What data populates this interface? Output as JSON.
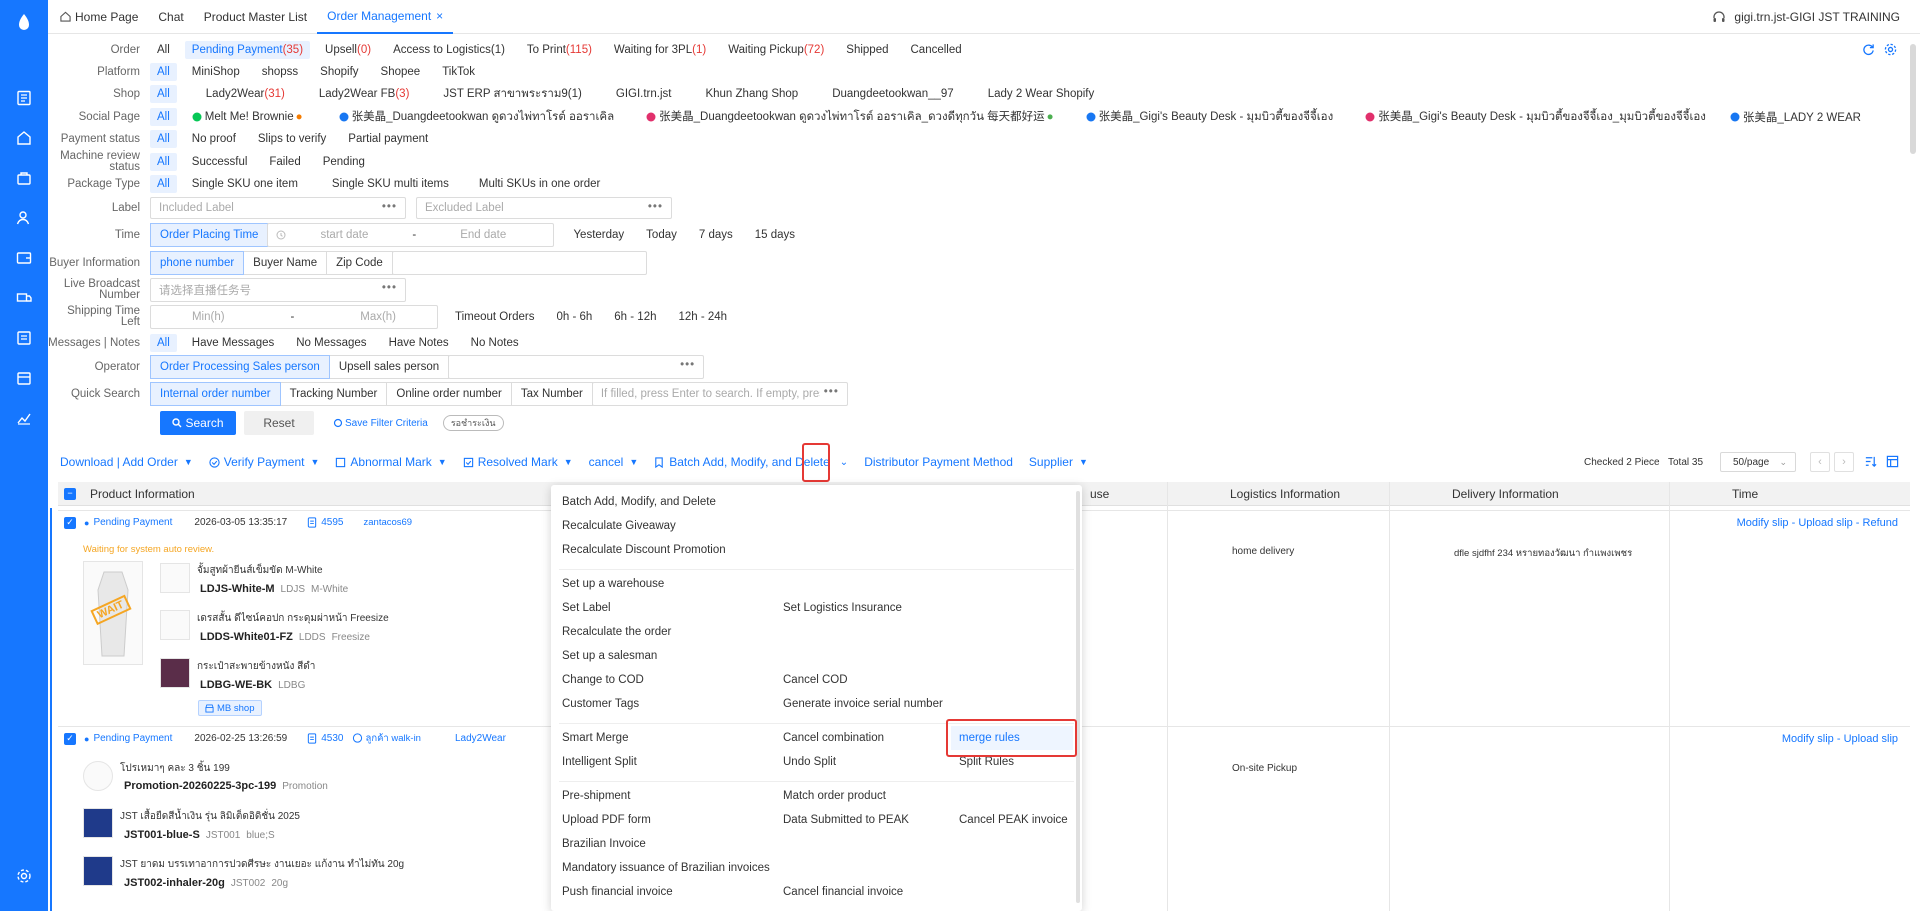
{
  "topbar": {
    "tabs": [
      "Home Page",
      "Chat",
      "Product Master List",
      "Order Management"
    ],
    "close": "×",
    "user": "gigi.trn.jst-GIGI JST TRAINING"
  },
  "filters": {
    "order": {
      "label": "Order",
      "options": [
        "All",
        "Pending Payment",
        "Upsell",
        "Access to Logistics",
        "To Print",
        "Waiting for 3PL",
        "Waiting Pickup",
        "Shipped",
        "Cancelled"
      ],
      "counts": [
        "",
        "(35)",
        "(0)",
        "(1)",
        "(115)",
        "(1)",
        "(72)",
        "",
        ""
      ]
    },
    "platform": {
      "label": "Platform",
      "options": [
        "All",
        "MiniShop",
        "shopss",
        "Shopify",
        "Shopee",
        "TikTok"
      ]
    },
    "shop": {
      "label": "Shop",
      "options": [
        "All",
        "Lady2Wear",
        "Lady2Wear FB",
        "JST ERP สาขาพระราม9(1)",
        "GIGI.trn.jst",
        "Khun Zhang Shop",
        "Duangdeetookwan__97",
        "Lady 2 Wear Shopify"
      ],
      "counts": [
        "",
        "(31)",
        "(3)",
        "",
        "",
        "",
        "",
        ""
      ]
    },
    "social": {
      "label": "Social Page",
      "options": [
        "All",
        "Melt Me! Brownie",
        "张美晶_Duangdeetookwan ดูดวงไพ่ทาโรต์ ออราเคิล",
        "张美晶_Duangdeetookwan ดูดวงไพ่ทาโรต์ ออราเคิล_ดวงดีทุกวัน 每天都好运",
        "张美晶_Gigi's Beauty Desk - มุมบิวตี้ของจีจี้เอง",
        "张美晶_Gigi's Beauty Desk - มุมบิวตี้ของจีจี้เอง_มุมบิวตี้ของจีจี้เอง",
        "张美晶_LADY 2 WEAR"
      ]
    },
    "payment": {
      "label": "Payment status",
      "options": [
        "All",
        "No proof",
        "Slips to verify",
        "Partial payment"
      ]
    },
    "machine": {
      "label": "Machine review status",
      "options": [
        "All",
        "Successful",
        "Failed",
        "Pending"
      ]
    },
    "package": {
      "label": "Package Type",
      "options": [
        "All",
        "Single SKU one item",
        "Single SKU multi items",
        "Multi SKUs in one order"
      ]
    },
    "label": {
      "label": "Label",
      "included": "Included Label",
      "excluded": "Excluded Label"
    },
    "time": {
      "label": "Time",
      "type": "Order Placing Time",
      "start": "start date",
      "dash": "-",
      "end": "End date",
      "quick": [
        "Yesterday",
        "Today",
        "7 days",
        "15 days"
      ]
    },
    "buyer": {
      "label": "Buyer Information",
      "options": [
        "phone number",
        "Buyer Name",
        "Zip Code"
      ]
    },
    "live": {
      "label": "Live Broadcast Number",
      "placeholder": "请选择直播任务号"
    },
    "shipping": {
      "label": "Shipping Time Left",
      "min": "Min(h)",
      "dash": "-",
      "max": "Max(h)",
      "options": [
        "Timeout Orders",
        "0h - 6h",
        "6h - 12h",
        "12h - 24h"
      ]
    },
    "messages": {
      "label": "Messages | Notes",
      "options": [
        "All",
        "Have Messages",
        "No Messages",
        "Have Notes",
        "No Notes"
      ]
    },
    "operator": {
      "label": "Operator",
      "options": [
        "Order Processing Sales person",
        "Upsell sales person"
      ]
    },
    "quick": {
      "label": "Quick Search",
      "options": [
        "Internal order number",
        "Tracking Number",
        "Online order number",
        "Tax Number"
      ],
      "placeholder": "If filled, press Enter to search. If empty, pres"
    },
    "search_btn": "Search",
    "reset_btn": "Reset",
    "save_filter": "Save Filter Criteria",
    "saved_tag": "รอชำระเงิน"
  },
  "toolbar": {
    "items": [
      "Download | Add Order",
      "Verify Payment",
      "Abnormal Mark",
      "Resolved Mark",
      "cancel",
      "Batch Add, Modify, and Delete",
      "Distributor Payment Method",
      "Supplier"
    ],
    "checked": "Checked 2 Piece",
    "total": "Total 35",
    "per_page": "50/page"
  },
  "table": {
    "headers": [
      "Product Information",
      "Logistics Information",
      "Delivery Information",
      "Time"
    ],
    "header_partial": "use"
  },
  "orders": [
    {
      "status": "Pending Payment",
      "date": "2026-03-05 13:35:17",
      "id": "4595",
      "buyer": "zantacos69",
      "note": "Waiting for system auto review.",
      "actions": "Modify slip - Upload slip - Refund",
      "logistics": "home delivery",
      "delivery": "dfle sjdfhf 234 หรายทองวัฒนา กำแพงเพชร",
      "wait": "WAIT",
      "items": [
        {
          "name": "จั้มสูทผ้ายีนส์เข็มขัด M-White",
          "sku": "LDJS-White-M",
          "code": "LDJS",
          "var": "M-White"
        },
        {
          "name": "เดรสสั้น ดีไซน์คอปก กระดุมผ่าหน้า Freesize",
          "sku": "LDDS-White01-FZ",
          "code": "LDDS",
          "var": "Freesize"
        },
        {
          "name": "กระเป๋าสะพายข้างหนัง สีดำ",
          "sku": "LDBG-WE-BK",
          "code": "LDBG",
          "var": ""
        }
      ],
      "shop_tag": "MB shop"
    },
    {
      "status": "Pending Payment",
      "date": "2026-02-25 13:26:59",
      "id": "4530",
      "buyer": "ลูกค้า walk-in",
      "shop": "Lady2Wear",
      "actions": "Modify slip - Upload slip",
      "logistics": "On-site Pickup",
      "items": [
        {
          "name": "โปรเหมาๆ คละ 3 ชิ้น 199",
          "sku": "Promotion-20260225-3pc-199",
          "code": "Promotion",
          "var": ""
        },
        {
          "name": "JST เสื้อยืดสีน้ำเงิน รุ่น ลิมิเต็ดอิดิชั่น 2025",
          "sku": "JST001-blue-S",
          "code": "JST001",
          "var": "blue;S"
        },
        {
          "name": "JST ยาดม บรรเทาอาการปวดศีรษะ งานเยอะ แก้งาน ทำไม่ทัน 20g",
          "sku": "JST002-inhaler-20g",
          "code": "JST002",
          "var": "20g"
        }
      ]
    }
  ],
  "menu": {
    "group1": [
      "Batch Add, Modify, and Delete",
      "Recalculate Giveaway",
      "Recalculate Discount Promotion"
    ],
    "group2_left": [
      "Set up a warehouse",
      "Set Label",
      "Recalculate the order",
      "Set up a salesman",
      "Change to COD",
      "Customer Tags"
    ],
    "group2_right": [
      "Set Logistics Insurance",
      "Cancel COD",
      "Generate invoice serial number"
    ],
    "group3": [
      "Smart Merge",
      "Cancel combination",
      "merge rules",
      "Intelligent Split",
      "Undo Split",
      "Split Rules"
    ],
    "group4": [
      "Pre-shipment",
      "Match order product",
      "Upload PDF form",
      "Data Submitted to PEAK",
      "Cancel PEAK invoice",
      "Brazilian Invoice",
      "Mandatory issuance of Brazilian invoices",
      "Push financial invoice",
      "Cancel financial invoice"
    ]
  },
  "colors": {
    "accent": "#1677ff",
    "highlight": "#e53935",
    "note": "#f5a623"
  }
}
